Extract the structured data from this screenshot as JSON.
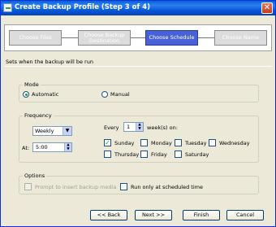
{
  "window": {
    "title": "Create Backup Profile (Step 3 of 4)"
  },
  "steps": [
    {
      "label": "Choose Files"
    },
    {
      "label": "Choose Backup Destination"
    },
    {
      "label": "Choose Schedule"
    },
    {
      "label": "Choose Name"
    }
  ],
  "subtitle": "Sets when the backup will be run",
  "mode": {
    "legend": "Mode",
    "options": [
      "Automatic",
      "Manual"
    ],
    "selected": "Automatic"
  },
  "frequency": {
    "legend": "Frequency",
    "period": "Weekly",
    "at_label": "At:",
    "time": "5:00",
    "every_label": "Every",
    "every_value": "1",
    "weeks_suffix": "week(s) on:",
    "days": [
      "Sunday",
      "Monday",
      "Tuesday",
      "Wednesday",
      "Thursday",
      "Friday",
      "Saturday"
    ],
    "checked_days": [
      "Sunday"
    ]
  },
  "options": {
    "legend": "Options",
    "prompt_media": "Prompt to insert backup media",
    "run_scheduled": "Run only at scheduled time"
  },
  "buttons": {
    "back": "<< Back",
    "next": "Next >>",
    "finish": "Finish",
    "cancel": "Cancel"
  },
  "colors": {
    "titlebar": "#0553d6",
    "active_step": "#4961d7",
    "inactive_step": "#dcdcdc",
    "window_bg": "#ece9d8"
  }
}
